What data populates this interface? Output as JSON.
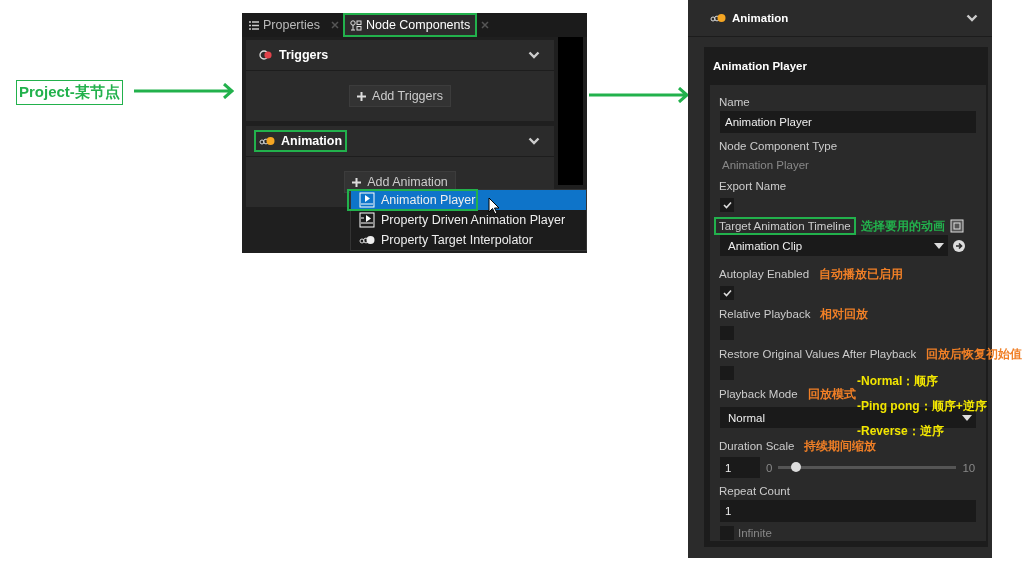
{
  "annotation": {
    "text": "Project-某节点"
  },
  "node_panel": {
    "tabs": [
      {
        "label": "Properties",
        "selected": false,
        "highlighted": false
      },
      {
        "label": "Node Components",
        "selected": true,
        "highlighted": true
      }
    ],
    "sections": [
      {
        "title": "Triggers",
        "kind": "trigger",
        "highlighted": false,
        "button": "Add Triggers"
      },
      {
        "title": "Animation",
        "kind": "animation",
        "highlighted": true,
        "button": "Add Animation"
      }
    ],
    "menu": [
      {
        "label": "Animation Player",
        "kind": "player",
        "selected": true,
        "highlighted": true
      },
      {
        "label": "Property Driven Animation Player",
        "kind": "driven",
        "selected": false,
        "highlighted": false
      },
      {
        "label": "Property Target Interpolator",
        "kind": "interpolator",
        "selected": false,
        "highlighted": false
      }
    ]
  },
  "inspector": {
    "header": "Animation",
    "card_title": "Animation Player",
    "fields": [
      {
        "kind": "text",
        "label": "Name",
        "value": "Animation Player"
      },
      {
        "kind": "readonly",
        "label": "Node Component Type",
        "value": "Animation Player"
      },
      {
        "kind": "checkbox",
        "label": "Export Name",
        "checked": true
      },
      {
        "kind": "reference",
        "label": "Target Animation Timeline",
        "value": "Animation Clip",
        "highlighted": true,
        "note": {
          "text": "选择要用的动画",
          "kind": "hint"
        }
      },
      {
        "kind": "checkbox",
        "label": "Autoplay Enabled",
        "checked": true,
        "note": {
          "text": "自动播放已启用",
          "kind": "translation"
        }
      },
      {
        "kind": "checkbox",
        "label": "Relative Playback",
        "checked": false,
        "note": {
          "text": "相对回放",
          "kind": "translation"
        }
      },
      {
        "kind": "checkbox",
        "label": "Restore Original Values After Playback",
        "checked": false,
        "note": {
          "text": "回放后恢复初始值",
          "kind": "translation"
        }
      },
      {
        "kind": "select",
        "label": "Playback Mode",
        "value": "Normal",
        "note": {
          "text": "回放模式",
          "kind": "translation"
        }
      },
      {
        "kind": "slider",
        "label": "Duration Scale",
        "value": "1",
        "min": "0",
        "max": "10",
        "level": 0.1,
        "note": {
          "text": "持续期间缩放",
          "kind": "translation"
        }
      },
      {
        "kind": "count",
        "label": "Repeat Count",
        "value": "1",
        "option": {
          "label": "Infinite",
          "checked": false
        }
      }
    ]
  },
  "mode_notes": [
    "-Normal：顺序",
    "-Ping pong：顺序+逆序",
    "-Reverse：逆序"
  ]
}
